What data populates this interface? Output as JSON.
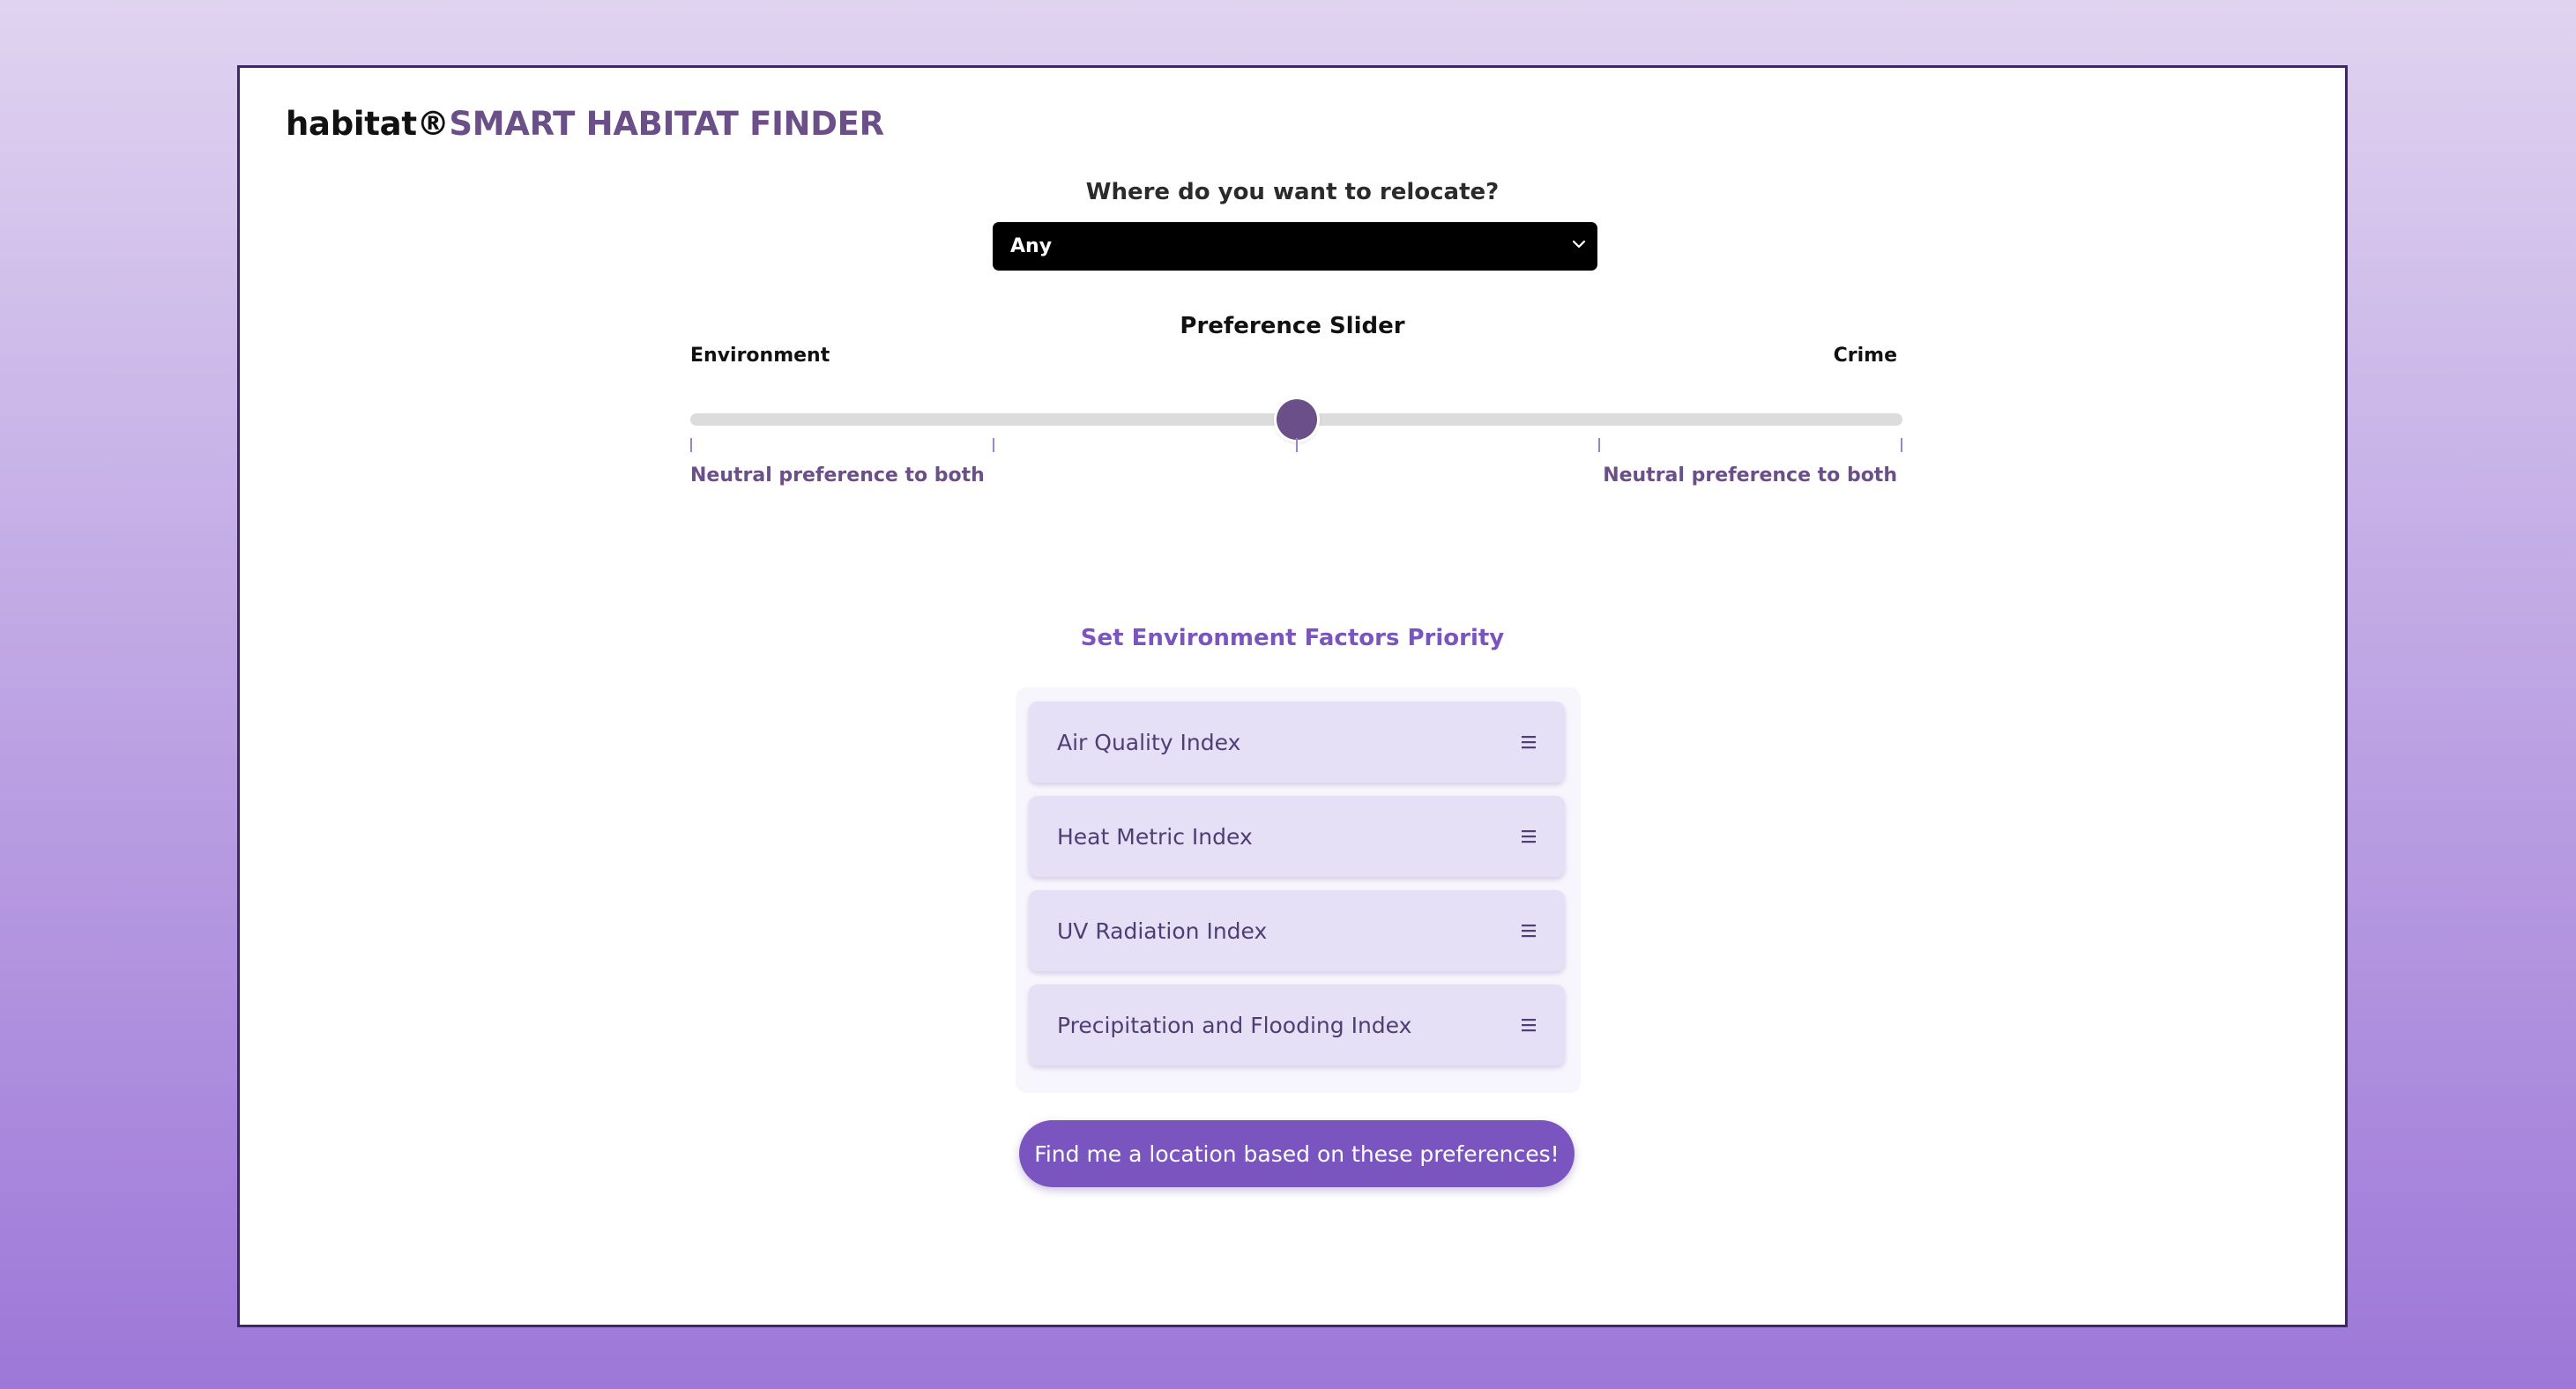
{
  "brand": {
    "name": "habitat®",
    "product": "SMART HABITAT FINDER"
  },
  "relocate": {
    "question": "Where do you want to relocate?",
    "selected": "Any"
  },
  "preference": {
    "title": "Preference Slider",
    "left_label": "Environment",
    "right_label": "Crime",
    "value_fraction": 0.5,
    "tick_count": 5,
    "left_hint": "Neutral preference to both",
    "right_hint": "Neutral preference to both"
  },
  "factors": {
    "title": "Set Environment Factors Priority",
    "items": [
      {
        "label": "Air Quality Index"
      },
      {
        "label": "Heat Metric Index"
      },
      {
        "label": "UV Radiation Index"
      },
      {
        "label": "Precipitation and Flooding Index"
      }
    ]
  },
  "action": {
    "label": "Find me a location based on these preferences!"
  },
  "colors": {
    "accent": "#7a55c0",
    "brand_purple": "#6a4f88",
    "item_bg": "#e6e0f7"
  }
}
